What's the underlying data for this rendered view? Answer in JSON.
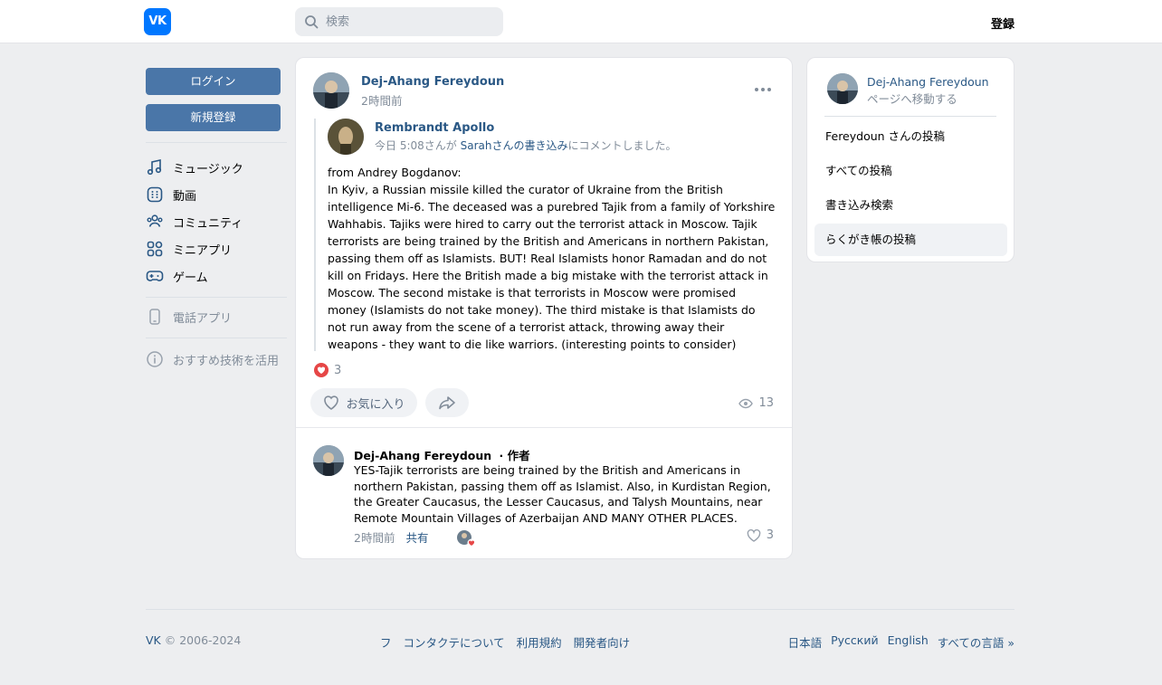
{
  "header": {
    "logo_text": "VK",
    "search_placeholder": "検索",
    "register_label": "登録"
  },
  "sidebar": {
    "login_label": "ログイン",
    "signup_label": "新規登録",
    "items": [
      {
        "label": "ミュージック",
        "icon": "music-icon"
      },
      {
        "label": "動画",
        "icon": "video-icon"
      },
      {
        "label": "コミュニティ",
        "icon": "community-icon"
      },
      {
        "label": "ミニアプリ",
        "icon": "apps-icon"
      },
      {
        "label": "ゲーム",
        "icon": "gamepad-icon"
      }
    ],
    "phone_app_label": "電話アプリ",
    "recommend_label": "おすすめ技術を活用"
  },
  "post": {
    "author": "Dej-Ahang Fereydoun",
    "time": "2時間前",
    "repost": {
      "author": "Rembrandt Apollo",
      "sub_prefix": "今日 5:08さんが",
      "sub_link": "Sarahさんの書き込み",
      "sub_suffix": "にコメントしました。",
      "text": "from Andrey Bogdanov:\nIn Kyiv, a Russian missile killed the curator of Ukraine from the British intelligence Mi-6. The deceased was a purebred Tajik from a family of Yorkshire Wahhabis. Tajiks were hired to carry out the terrorist attack in Moscow. Tajik terrorists are being trained by the British and Americans in northern Pakistan, passing them off as Islamists. BUT! Real Islamists honor Ramadan and do not kill on Fridays. Here the British made a big mistake with the terrorist attack in Moscow. The second mistake is that terrorists in Moscow were promised money (Islamists do not take money). The third mistake is that Islamists do not run away from the scene of a terrorist attack, throwing away their weapons - they want to die like warriors. (interesting points to consider)"
    },
    "likes": "3",
    "favorite_label": "お気に入り",
    "views": "13",
    "comment": {
      "author": "Dej-Ahang Fereydoun",
      "author_tag": "· 作者",
      "text": "YES-Tajik terrorists are being trained by the British and Americans in northern Pakistan, passing them off as Islamist. Also, in Kurdistan Region, the Greater Caucasus, the Lesser Caucasus, and Talysh Mountains, near Remote Mountain Villages of Azerbaijan AND MANY OTHER PLACES.",
      "time": "2時間前",
      "share_label": "共有",
      "likes": "3"
    }
  },
  "right_card": {
    "name": "Dej-Ahang Fereydoun",
    "sub": "ページへ移動する",
    "items": [
      {
        "label": "Fereydoun さんの投稿",
        "active": false
      },
      {
        "label": "すべての投稿",
        "active": false
      },
      {
        "label": "書き込み検索",
        "active": false
      },
      {
        "label": "らくがき帳の投稿",
        "active": true
      }
    ]
  },
  "footer": {
    "brand": "VK",
    "copyright": "© 2006-2024",
    "mid_links": [
      "フ",
      "コンタクテについて",
      "利用規約",
      "開発者向け"
    ],
    "lang_links": [
      "日本語",
      "Русский",
      "English",
      "すべての言語 »"
    ]
  },
  "colors": {
    "accent": "#2a5885",
    "button_blue": "#4a76a8",
    "vk_blue": "#0077ff",
    "like_red": "#e64646"
  }
}
